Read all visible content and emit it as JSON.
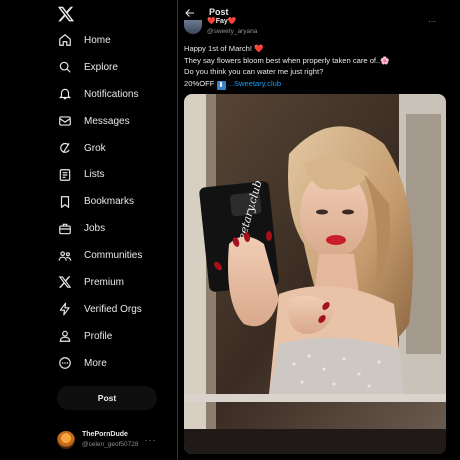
{
  "sidebar": {
    "logo_icon": "x-logo-icon",
    "items": [
      {
        "label": "Home",
        "icon": "home-icon"
      },
      {
        "label": "Explore",
        "icon": "search-icon"
      },
      {
        "label": "Notifications",
        "icon": "bell-icon"
      },
      {
        "label": "Messages",
        "icon": "envelope-icon"
      },
      {
        "label": "Grok",
        "icon": "grok-icon"
      },
      {
        "label": "Lists",
        "icon": "list-icon"
      },
      {
        "label": "Bookmarks",
        "icon": "bookmark-icon"
      },
      {
        "label": "Jobs",
        "icon": "briefcase-icon"
      },
      {
        "label": "Communities",
        "icon": "people-icon"
      },
      {
        "label": "Premium",
        "icon": "x-logo-icon"
      },
      {
        "label": "Verified Orgs",
        "icon": "lightning-icon"
      },
      {
        "label": "Profile",
        "icon": "person-icon"
      },
      {
        "label": "More",
        "icon": "more-circle-icon"
      }
    ],
    "post_button": "Post",
    "account": {
      "name": "ThePornDude",
      "handle": "@celen_geof50728",
      "more": "···"
    }
  },
  "header": {
    "title": "Post"
  },
  "tweet": {
    "author_name": "❤️Fay❤️",
    "author_handle": "@sweety_aryana",
    "line1": "Happy 1st of March! ",
    "line1_emoji": "❤️",
    "line2": "They say flowers bloom best when properly taken care of..",
    "line2_emoji": "🌸",
    "line3": "Do you think you can water me just right?",
    "line4_prefix": "20%OFF ",
    "line4_emoji": "⬇",
    "link_text": "...Sweetary.club",
    "media_overlay_text": "sweetary.club"
  },
  "colors": {
    "background": "#000000",
    "text": "#e7e9ea",
    "muted": "#8a8d91",
    "link": "#1d9bf0",
    "border": "#2f3336"
  }
}
